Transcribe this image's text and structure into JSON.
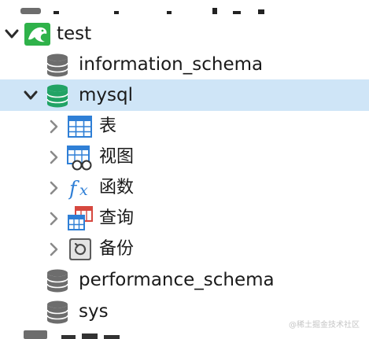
{
  "tree": {
    "connection": {
      "label": "test",
      "icon": "mysql-dolphin-icon",
      "expanded": true
    },
    "databases": [
      {
        "label": "information_schema",
        "icon": "database-icon",
        "expanded": false
      },
      {
        "label": "mysql",
        "icon": "database-icon",
        "expanded": true,
        "selected": true,
        "children": [
          {
            "label": "表",
            "icon": "table-icon"
          },
          {
            "label": "视图",
            "icon": "view-icon"
          },
          {
            "label": "函数",
            "icon": "function-icon"
          },
          {
            "label": "查询",
            "icon": "query-icon"
          },
          {
            "label": "备份",
            "icon": "backup-icon"
          }
        ]
      },
      {
        "label": "performance_schema",
        "icon": "database-icon",
        "expanded": false
      },
      {
        "label": "sys",
        "icon": "database-icon",
        "expanded": false
      }
    ]
  },
  "watermark": "@稀土掘金技术社区",
  "colors": {
    "selection": "#cfe5f7",
    "database_gray": "#6d6d6d",
    "database_active": "#21a365",
    "dolphin_bg": "#2fb24a",
    "table_blue": "#2f7fd6",
    "query_red": "#d6483f"
  }
}
